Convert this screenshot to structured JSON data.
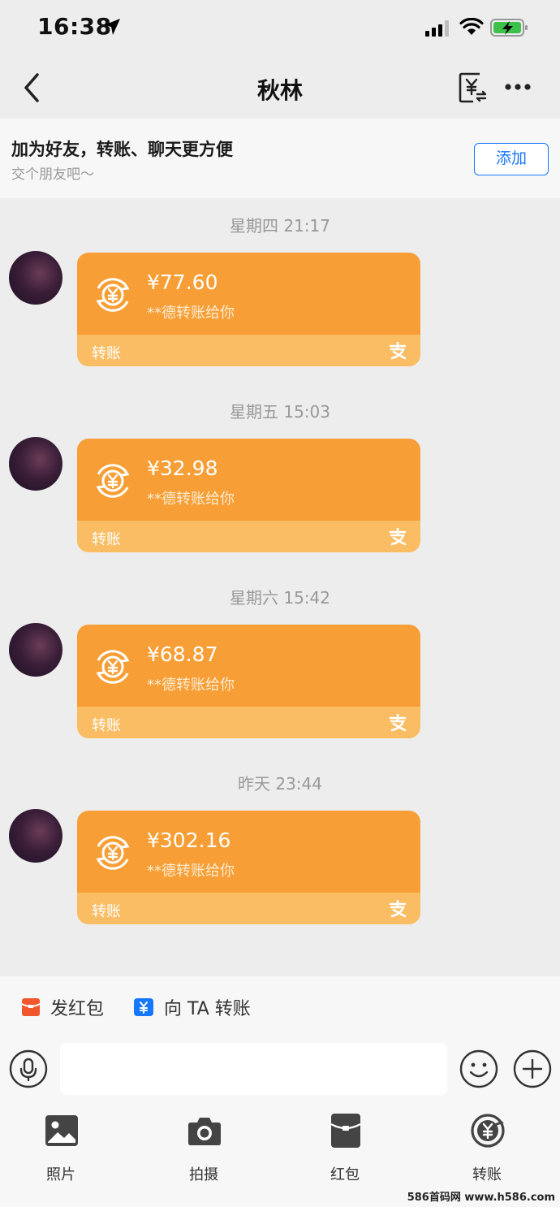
{
  "status_bar": {
    "time": "16:38"
  },
  "nav": {
    "title": "秋林",
    "icons": [
      "back-icon",
      "transfer-icon",
      "more-icon"
    ]
  },
  "banner": {
    "title": "加为好友，转账、聊天更方便",
    "subtitle": "交个朋友吧～",
    "add_label": "添加"
  },
  "messages": [
    {
      "time": "星期四 21:17",
      "amount": "¥77.60",
      "desc": "**德转账给你",
      "label": "转账"
    },
    {
      "time": "星期五 15:03",
      "amount": "¥32.98",
      "desc": "**德转账给你",
      "label": "转账"
    },
    {
      "time": "星期六 15:42",
      "amount": "¥68.87",
      "desc": "**德转账给你",
      "label": "转账"
    },
    {
      "time": "昨天 23:44",
      "amount": "¥302.16",
      "desc": "**德转账给你",
      "label": "转账"
    }
  ],
  "quick_actions": [
    {
      "label": "发红包",
      "icon": "red-packet-icon"
    },
    {
      "label": "向 TA 转账",
      "icon": "transfer-icon"
    }
  ],
  "input": {
    "placeholder": ""
  },
  "tools": [
    {
      "label": "照片",
      "icon": "photo-icon"
    },
    {
      "label": "拍摄",
      "icon": "camera-icon"
    },
    {
      "label": "红包",
      "icon": "red-packet-icon"
    },
    {
      "label": "转账",
      "icon": "transfer-icon"
    }
  ],
  "colors": {
    "bubble": "#f79f36",
    "bubble_footer": "#fabd63",
    "accent": "#1677ff",
    "background": "#ededed"
  },
  "watermark": "586首码网 www.h586.com"
}
